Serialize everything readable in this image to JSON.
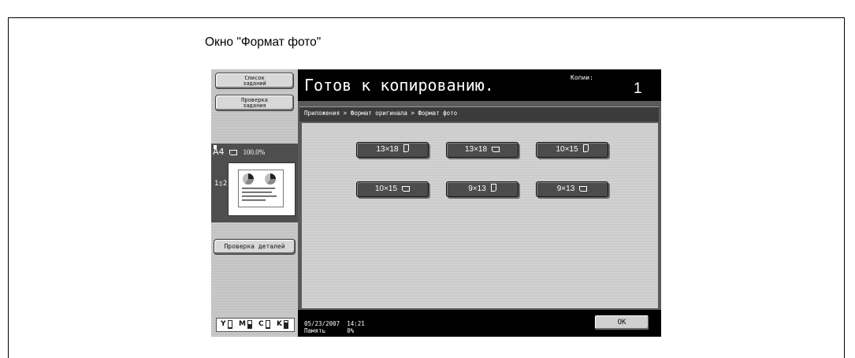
{
  "caption": "Окно \"Формат фото\"",
  "left_panel": {
    "job_list": [
      "Список",
      "заданий"
    ],
    "check_job": [
      "Проверка",
      "задания"
    ],
    "paper_size": "A4",
    "zoom": "100.0%",
    "duplex": "1▯2",
    "check_details": "Проверка деталей",
    "toner": [
      {
        "letter": "Y",
        "level": 0.1
      },
      {
        "letter": "M",
        "level": 0.55
      },
      {
        "letter": "C",
        "level": 0.1
      },
      {
        "letter": "K",
        "level": 0.8
      }
    ]
  },
  "header": {
    "status": "Готов к копированию.",
    "copies_label": "Копии:",
    "copies_value": "1"
  },
  "breadcrumb": "Приложения > Формат оригинала > Формат фото",
  "formats": [
    {
      "label": "13×18",
      "orientation": "portrait"
    },
    {
      "label": "13×18",
      "orientation": "landscape"
    },
    {
      "label": "10×15",
      "orientation": "portrait"
    },
    {
      "label": "10×15",
      "orientation": "landscape"
    },
    {
      "label": "9×13",
      "orientation": "portrait"
    },
    {
      "label": "9×13",
      "orientation": "landscape"
    }
  ],
  "footer": {
    "date": "05/23/2007",
    "time": "14:21",
    "memory_label": "Память",
    "memory_value": "0%",
    "ok_label": "OK"
  }
}
